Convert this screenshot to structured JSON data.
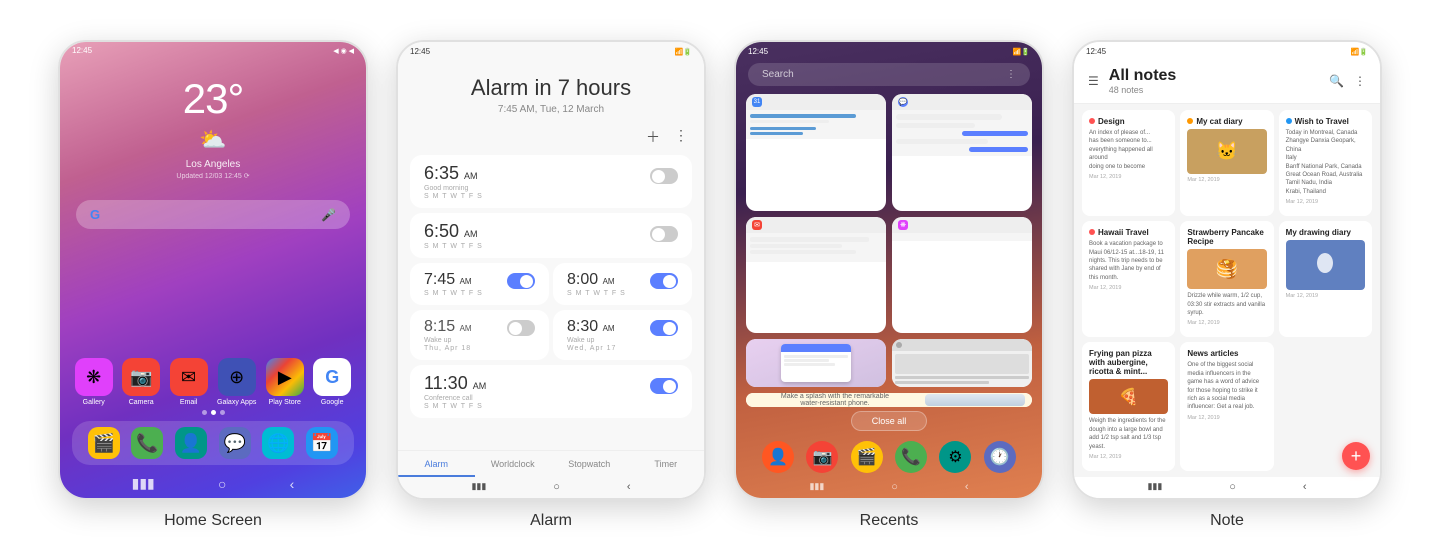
{
  "screens": [
    {
      "id": "home-screen",
      "label": "Home Screen",
      "statusBar": {
        "time": "12:45",
        "icons": "◀ ◉ ◀"
      },
      "weather": {
        "temp": "23°",
        "icon": "⛅",
        "location": "Los Angeles",
        "updated": "Updated 12/03 12:45 ⟳"
      },
      "searchBar": {
        "g": "G",
        "mic": "🎤"
      },
      "apps": [
        {
          "label": "Gallery",
          "icon": "❋",
          "color": "bg-pink"
        },
        {
          "label": "Camera",
          "icon": "📷",
          "color": "bg-red"
        },
        {
          "label": "Email",
          "icon": "✉",
          "color": "bg-red"
        },
        {
          "label": "Galaxy Apps",
          "icon": "⊕",
          "color": "bg-dark-blue"
        },
        {
          "label": "Play Store",
          "icon": "▶",
          "color": "bg-multicolor"
        },
        {
          "label": "Google",
          "icon": "G",
          "color": "bg-multicolor"
        }
      ],
      "dock": [
        {
          "label": "",
          "icon": "🎬",
          "color": "bg-yellow"
        },
        {
          "label": "",
          "icon": "📞",
          "color": "bg-green"
        },
        {
          "label": "",
          "icon": "👤",
          "color": "bg-teal"
        },
        {
          "label": "",
          "icon": "💬",
          "color": "bg-indigo"
        },
        {
          "label": "",
          "icon": "🌐",
          "color": "bg-cyan"
        },
        {
          "label": "",
          "icon": "📅",
          "color": "bg-blue"
        }
      ],
      "nav": [
        "▮▮▮",
        "○",
        "‹"
      ]
    },
    {
      "id": "alarm-screen",
      "label": "Alarm",
      "statusBar": {
        "time": "12:45",
        "icons": "◀ ◉ ◀"
      },
      "header": {
        "title": "Alarm in 7 hours",
        "subtitle": "7:45 AM, Tue, 12 March"
      },
      "alarms": [
        {
          "time": "6:35",
          "ampm": "AM",
          "days": "S M T W T F S",
          "label": "Good morning",
          "on": false
        },
        {
          "time": "6:50",
          "ampm": "AM",
          "days": "S M T W T F S",
          "label": "",
          "on": false
        },
        {
          "time": "7:45",
          "ampm": "AM",
          "days": "S M T W T F S",
          "label": "",
          "on": true
        },
        {
          "time": "8:00",
          "ampm": "AM",
          "days": "S M T W T F S",
          "label": "",
          "on": true
        },
        {
          "time": "8:15",
          "ampm": "AM",
          "days": "Thu, Apr 18",
          "label": "Wake up",
          "on": false
        },
        {
          "time": "8:30",
          "ampm": "AM",
          "days": "Wed, Apr 17",
          "label": "Wake up",
          "on": true
        },
        {
          "time": "11:30",
          "ampm": "AM",
          "days": "S M T W T F S",
          "label": "Conference call",
          "on": true
        }
      ],
      "tabs": [
        "Alarm",
        "Worldclock",
        "Stopwatch",
        "Timer"
      ],
      "activeTab": 0,
      "nav": [
        "▮▮▮",
        "○",
        "‹"
      ]
    },
    {
      "id": "recents-screen",
      "label": "Recents",
      "statusBar": {
        "time": "12:45",
        "icons": "◀ ◉ ◀"
      },
      "searchPlaceholder": "Search",
      "closeAllLabel": "Close all",
      "dockIcons": [
        {
          "icon": "👤",
          "color": "bg-orange"
        },
        {
          "icon": "📷",
          "color": "bg-red"
        },
        {
          "icon": "🎬",
          "color": "bg-yellow"
        },
        {
          "icon": "📞",
          "color": "bg-green"
        },
        {
          "icon": "⚙",
          "color": "bg-teal"
        },
        {
          "icon": "🕐",
          "color": "bg-indigo"
        }
      ],
      "nav": [
        "▮▮▮",
        "○",
        "‹"
      ]
    },
    {
      "id": "note-screen",
      "label": "Note",
      "statusBar": {
        "time": "12:45",
        "icons": "◀ ◉ ◀"
      },
      "header": {
        "title": "All notes",
        "count": "48 notes"
      },
      "notes": [
        {
          "title": "Design",
          "text": "An index of please of ...",
          "color": "#ff5252",
          "date": "Mar 12, 2019",
          "hasImage": false
        },
        {
          "title": "My cat diary",
          "text": "",
          "color": "#ff9800",
          "date": "Mar 12, 2019",
          "hasImage": true,
          "imageColor": "#c8a060"
        },
        {
          "title": "Wish to Travel",
          "text": "Today in Montreal, Canada...",
          "color": "#2196F3",
          "date": "Mar 12, 2019",
          "hasImage": false
        },
        {
          "title": "Hawaii Travel",
          "text": "Book a vacation package to Maui...",
          "color": "#ff5252",
          "date": "Mar 12, 2019",
          "hasImage": false
        },
        {
          "title": "Strawberry Pancake Recipe",
          "text": "Drizzle while warm...",
          "color": null,
          "date": "Mar 12, 2019",
          "hasImage": true,
          "imageColor": "#e0a080"
        },
        {
          "title": "My drawing diary",
          "text": "",
          "color": null,
          "date": "Mar 12, 2019",
          "hasImage": true,
          "imageColor": "#6080c0"
        },
        {
          "title": "Frying pan pizza with aubergine, ricotta & mint...",
          "text": "Weigh the ingredients...",
          "color": null,
          "date": "Mar 12, 2019",
          "hasImage": true,
          "imageColor": "#c06030"
        },
        {
          "title": "News articles",
          "text": "One of the biggest social media influencers...",
          "color": null,
          "date": "Mar 12, 2019",
          "hasImage": false
        }
      ],
      "fabLabel": "+",
      "nav": [
        "▮▮▮",
        "○",
        "‹"
      ]
    }
  ]
}
